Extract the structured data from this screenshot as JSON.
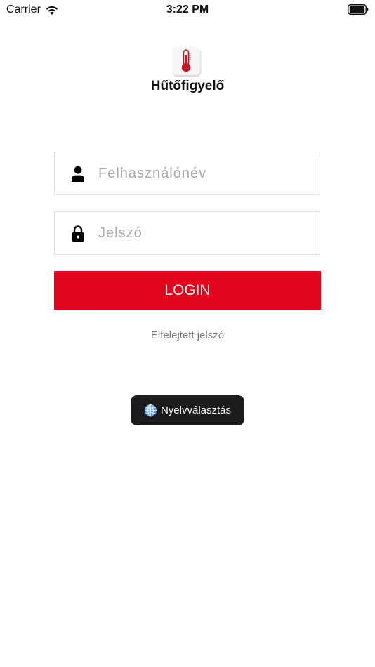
{
  "status_bar": {
    "carrier": "Carrier",
    "time": "3:22 PM"
  },
  "app": {
    "title": "Hűtőfigyelő",
    "logo_icon": "thermometer-icon"
  },
  "form": {
    "username_placeholder": "Felhasználónév",
    "username_value": "",
    "password_placeholder": "Jelszó",
    "password_value": "",
    "login_label": "LOGIN",
    "forgot_password_label": "Elfelejtett jelszó"
  },
  "language_button": {
    "label": "Nyelvválasztás",
    "icon": "globe-icon"
  },
  "colors": {
    "brand_red": "#e3051b",
    "dark_button": "#1c1c1e",
    "placeholder": "#a9a9a9",
    "link_gray": "#7a7a7a"
  }
}
